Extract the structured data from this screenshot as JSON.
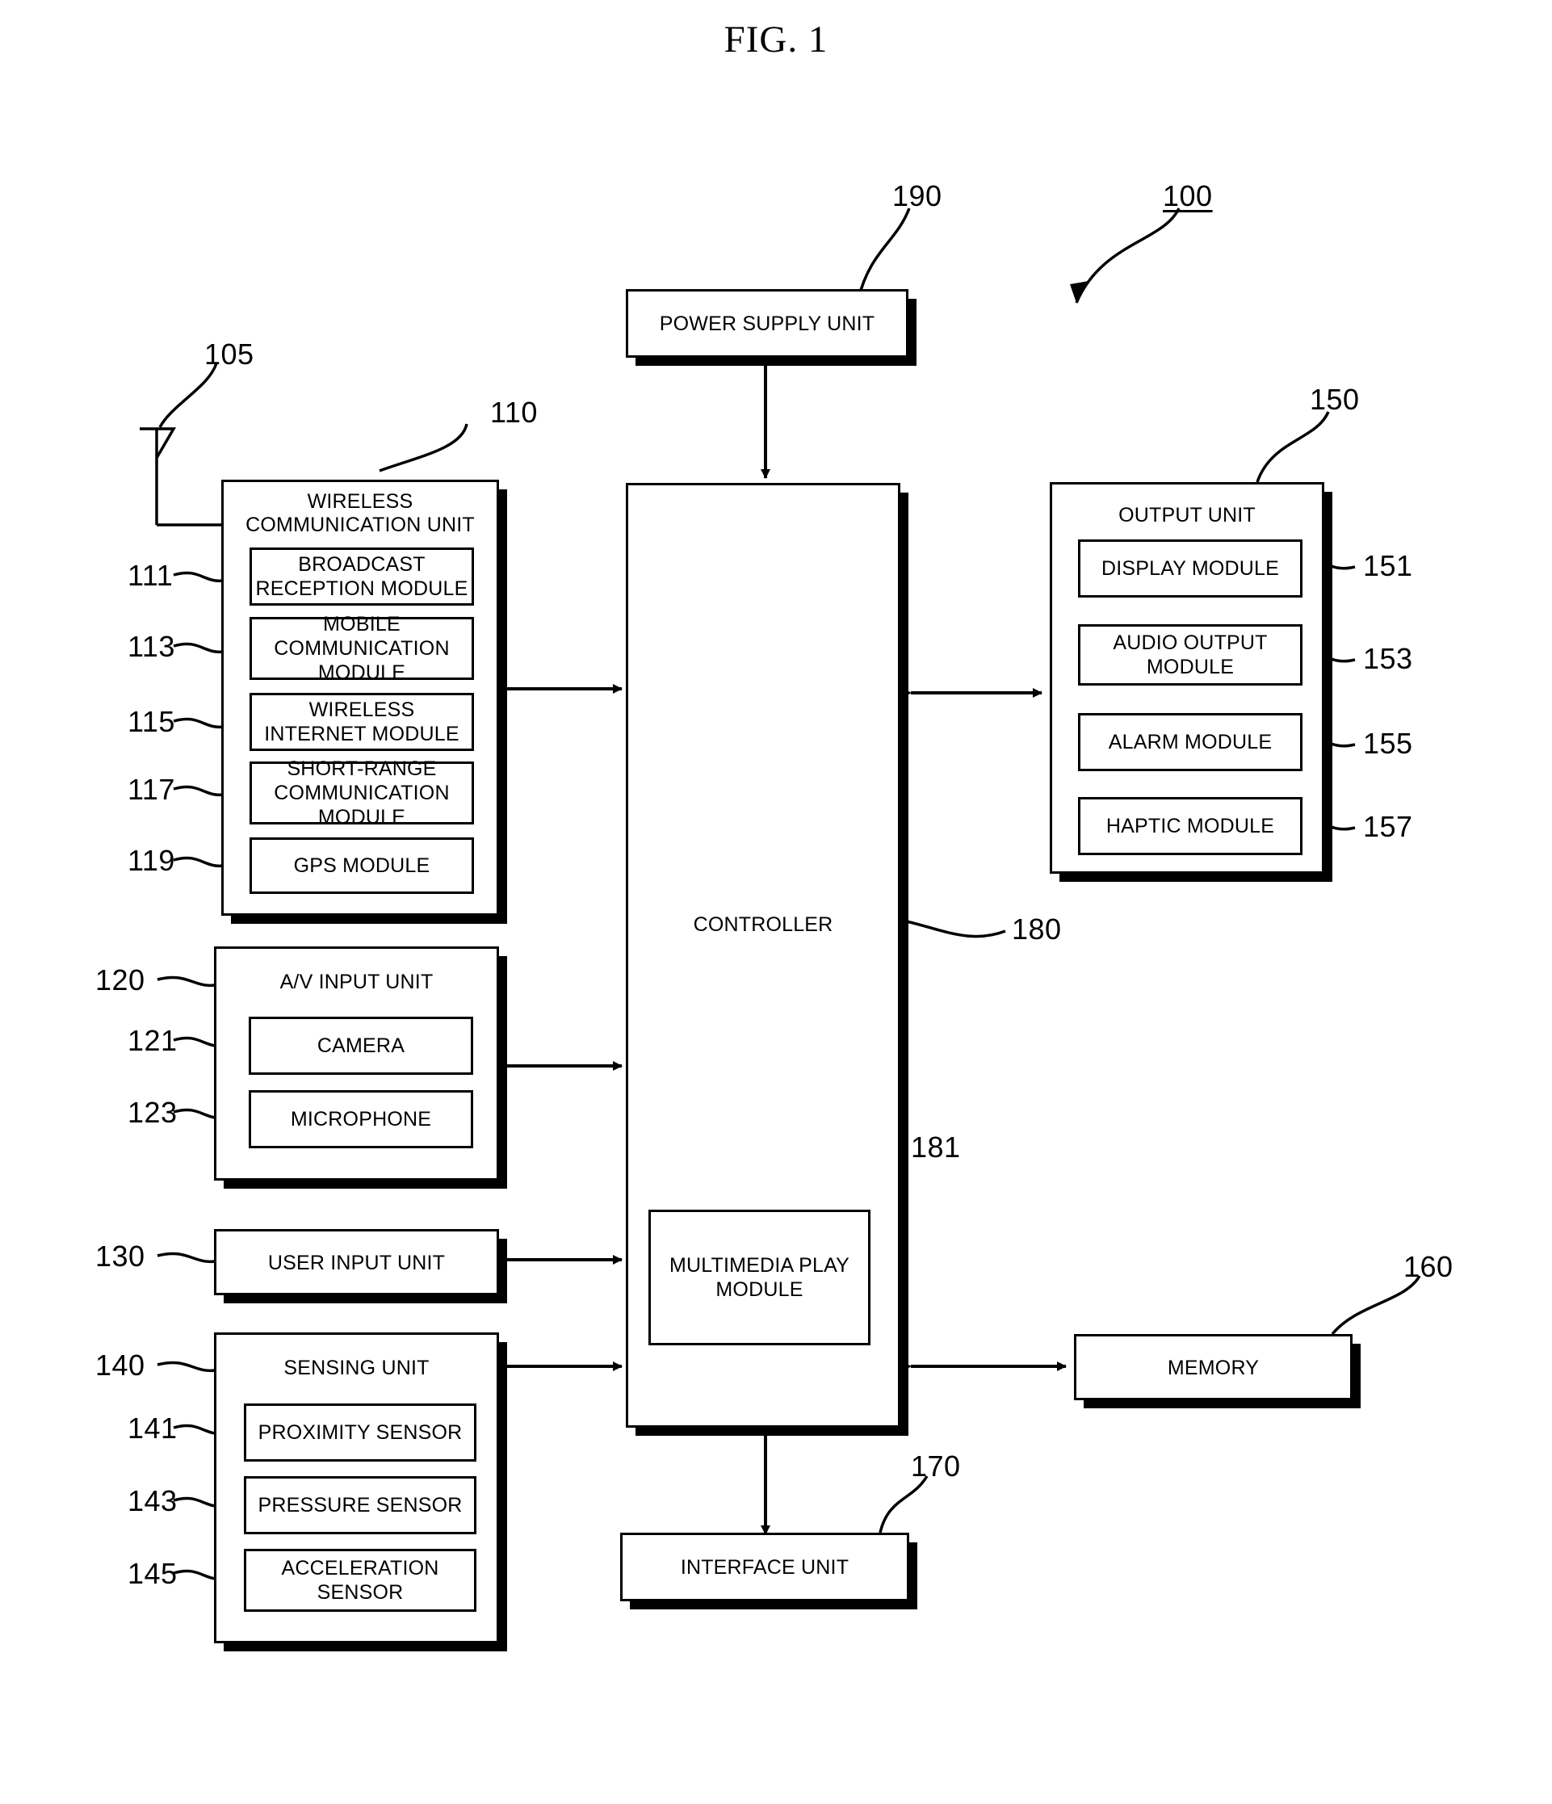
{
  "figure": {
    "title": "FIG. 1",
    "device_ref": "100",
    "antenna_ref": "105"
  },
  "blocks": {
    "power_supply": {
      "label": "POWER SUPPLY UNIT",
      "ref": "190"
    },
    "wireless_communication": {
      "label": "WIRELESS\nCOMMUNICATION UNIT",
      "ref": "110",
      "modules": [
        {
          "label": "BROADCAST\nRECEPTION MODULE",
          "ref": "111"
        },
        {
          "label": "MOBILE\nCOMMUNICATION\nMODULE",
          "ref": "113"
        },
        {
          "label": "WIRELESS\nINTERNET MODULE",
          "ref": "115"
        },
        {
          "label": "SHORT-RANGE\nCOMMUNICATION\nMODULE",
          "ref": "117"
        },
        {
          "label": "GPS MODULE",
          "ref": "119"
        }
      ]
    },
    "av_input": {
      "label": "A/V INPUT UNIT",
      "ref": "120",
      "modules": [
        {
          "label": "CAMERA",
          "ref": "121"
        },
        {
          "label": "MICROPHONE",
          "ref": "123"
        }
      ]
    },
    "user_input": {
      "label": "USER INPUT UNIT",
      "ref": "130"
    },
    "sensing": {
      "label": "SENSING UNIT",
      "ref": "140",
      "modules": [
        {
          "label": "PROXIMITY SENSOR",
          "ref": "141"
        },
        {
          "label": "PRESSURE SENSOR",
          "ref": "143"
        },
        {
          "label": "ACCELERATION\nSENSOR",
          "ref": "145"
        }
      ]
    },
    "controller": {
      "label": "CONTROLLER",
      "ref": "180",
      "modules": [
        {
          "label": "MULTIMEDIA\nPLAY MODULE",
          "ref": "181"
        }
      ]
    },
    "output": {
      "label": "OUTPUT UNIT",
      "ref": "150",
      "modules": [
        {
          "label": "DISPLAY MODULE",
          "ref": "151"
        },
        {
          "label": "AUDIO OUTPUT\nMODULE",
          "ref": "153"
        },
        {
          "label": "ALARM MODULE",
          "ref": "155"
        },
        {
          "label": "HAPTIC MODULE",
          "ref": "157"
        }
      ]
    },
    "memory": {
      "label": "MEMORY",
      "ref": "160"
    },
    "interface": {
      "label": "INTERFACE UNIT",
      "ref": "170"
    }
  },
  "colors": {
    "line": "#000000",
    "background": "#ffffff"
  }
}
